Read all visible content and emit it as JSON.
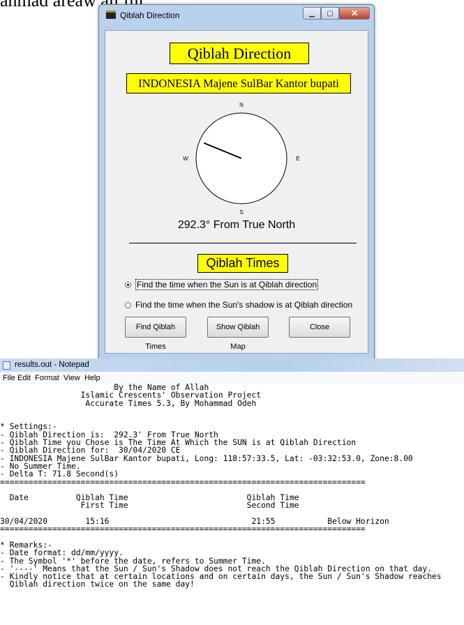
{
  "background_fragment": "ahmad areaw all ful.",
  "qiblah_window": {
    "title": "Qiblah Direction",
    "heading": "Qiblah Direction",
    "location": "INDONESIA Majene SulBar Kantor bupati",
    "compass": {
      "north": "N",
      "south": "S",
      "east": "E",
      "west": "W",
      "bearing_degrees": 292.3
    },
    "direction_text": "292.3° From True North",
    "times_heading": "Qiblah Times",
    "radio_sun": "Find the time when the Sun is at Qiblah direction",
    "radio_shadow": "Find the time when the Sun's shadow  is at Qiblah direction",
    "selected_radio": "sun",
    "btn_find": "Find Qiblah Times",
    "btn_map": "Show Qiblah  Map",
    "btn_close": "Close"
  },
  "notepad": {
    "title": "results.out - Notepad",
    "menu": [
      "File",
      "Edit",
      "Format",
      "View",
      "Help"
    ],
    "lines": [
      "                        By the Name of Allah",
      "                 Islamic Crescents' Observation Project",
      "                  Accurate Times 5.3, By Mohammad Odeh",
      "",
      "",
      "* Settings:-",
      "- Qiblah Direction is:  292.3' From True North",
      "- Qiblah Time you Chose is The Time At Which the SUN is at Qiblah Direction",
      "- Qiblah Direction for:  30/04/2020 CE",
      "- INDONESIA Majene SulBar Kantor bupati, Long: 118:57:33.5, Lat: -03:32:53.0, Zone:8.00",
      "- No Summer Time.",
      "- Delta T: 71.8 Second(s)",
      "=============================================================================",
      "",
      "  Date          Qiblah Time                         Qiblah Time",
      "                 First Time                         Second Time",
      "",
      "30/04/2020        15:16                              21:55           Below Horizon",
      "=============================================================================",
      "",
      "* Remarks:-",
      "- Date format: dd/mm/yyyy.",
      "- The Symbol '*' before the date, refers to Summer Time.",
      "- '----' Means that the Sun / Sun's Shadow does not reach the Qiblah Direction on that day.",
      "- Kindly notice that at certain locations and on certain days, the Sun / Sun's Shadow reaches",
      "  Qiblah direction twice on the same day!"
    ]
  }
}
